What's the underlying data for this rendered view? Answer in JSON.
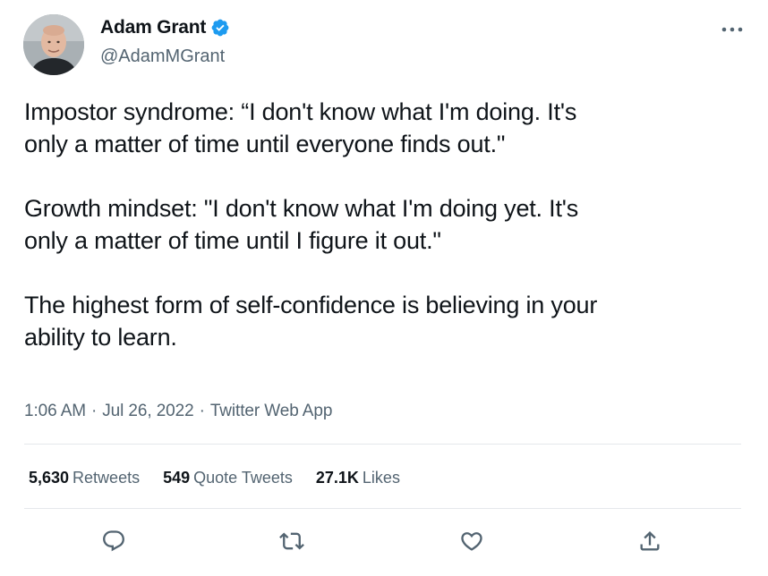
{
  "author": {
    "display_name": "Adam Grant",
    "handle": "@AdamMGrant",
    "verified": true,
    "avatar_icon": "avatar-photo"
  },
  "tweet": {
    "paragraphs": [
      "Impostor syndrome: “I don't know what I'm doing. It's\nonly a matter of time until everyone finds out.\"",
      "Growth mindset: \"I don't know what I'm doing yet. It's\nonly a matter of time until I figure it out.\"",
      "The highest form of self-confidence is believing in your\nability to learn."
    ]
  },
  "meta": {
    "time": "1:06 AM",
    "separator": "·",
    "date": "Jul 26, 2022",
    "source": "Twitter Web App"
  },
  "stats": {
    "retweets_count": "5,630",
    "retweets_label": "Retweets",
    "quotes_count": "549",
    "quotes_label": "Quote Tweets",
    "likes_count": "27.1K",
    "likes_label": "Likes"
  },
  "actions": [
    "reply-icon",
    "retweet-icon",
    "like-icon",
    "share-icon"
  ],
  "colors": {
    "text": "#0f1419",
    "secondary": "#536471",
    "verified": "#1d9bf0",
    "divider": "#e5e8eb"
  }
}
